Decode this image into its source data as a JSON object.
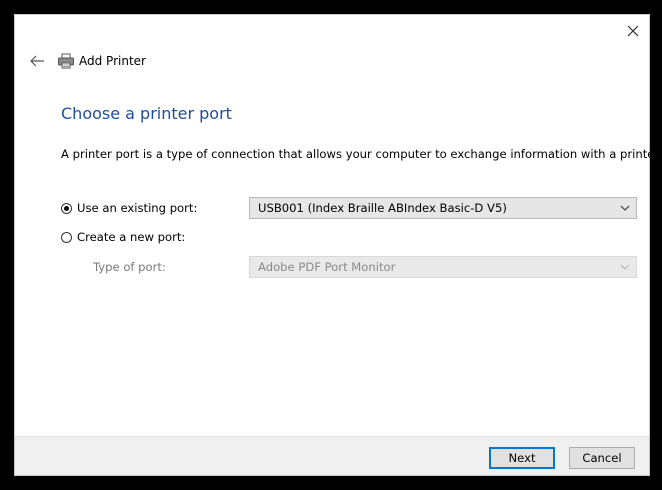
{
  "window": {
    "title": "Add Printer"
  },
  "page": {
    "heading": "Choose a printer port",
    "description": "A printer port is a type of connection that allows your computer to exchange information with a printer."
  },
  "options": {
    "existing_port": {
      "label": "Use an existing port:",
      "selected": true,
      "value": "USB001 (Index Braille ABIndex Basic-D V5)"
    },
    "new_port": {
      "label": "Create a new port:",
      "selected": false,
      "type_label": "Type of port:",
      "type_value": "Adobe PDF Port Monitor"
    }
  },
  "footer": {
    "next_label": "Next",
    "cancel_label": "Cancel"
  },
  "colors": {
    "heading": "#1f4e99",
    "primary_border": "#0078d7",
    "footer_bg": "#f0f0f0"
  },
  "icons": {
    "close": "close-icon",
    "back": "back-arrow-icon",
    "printer": "printer-icon",
    "dropdown": "chevron-down-icon"
  }
}
